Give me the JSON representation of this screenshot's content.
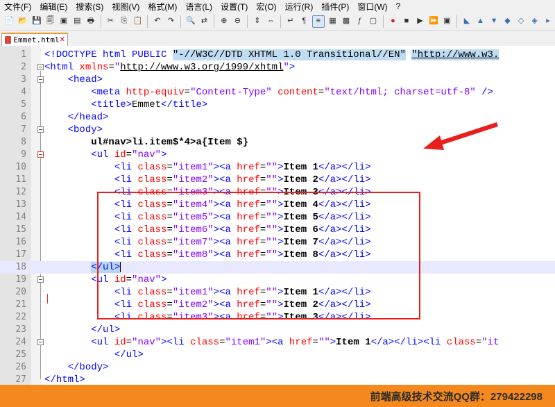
{
  "menu": [
    "文件(F)",
    "编辑(E)",
    "搜索(S)",
    "视图(V)",
    "格式(M)",
    "语言(L)",
    "设置(T)",
    "宏(O)",
    "运行(R)",
    "插件(P)",
    "窗口(W)",
    "?"
  ],
  "tab": {
    "title": "Emmet.html",
    "close": "✕"
  },
  "lines": [
    {
      "n": "1",
      "cur": false,
      "fold": null,
      "tokens": [
        {
          "c": "t",
          "x": "<!DOCTYPE html PUBLIC "
        },
        {
          "c": "hl",
          "x": "\"-//W3C//DTD XHTML 1.0 Transitional//EN\""
        },
        {
          "c": "d",
          "x": " "
        },
        {
          "c": "hl u",
          "x": "\"http://www.w3."
        }
      ]
    },
    {
      "n": "2",
      "cur": false,
      "fold": "open",
      "tokens": [
        {
          "c": "t",
          "x": "<html "
        },
        {
          "c": "a",
          "x": "xmlns"
        },
        {
          "c": "d",
          "x": "="
        },
        {
          "c": "s",
          "x": "\""
        },
        {
          "c": "s u",
          "x": "http://www.w3.org/1999/xhtml"
        },
        {
          "c": "s",
          "x": "\""
        },
        {
          "c": "t",
          "x": ">"
        }
      ]
    },
    {
      "n": "3",
      "cur": false,
      "fold": "open",
      "tokens": [
        {
          "c": "d",
          "x": "    "
        },
        {
          "c": "t",
          "x": "<head>"
        }
      ]
    },
    {
      "n": "4",
      "cur": false,
      "fold": null,
      "tokens": [
        {
          "c": "d",
          "x": "        "
        },
        {
          "c": "t",
          "x": "<meta "
        },
        {
          "c": "a",
          "x": "http-equiv"
        },
        {
          "c": "d",
          "x": "="
        },
        {
          "c": "s",
          "x": "\"Content-Type\""
        },
        {
          "c": "d",
          "x": " "
        },
        {
          "c": "a",
          "x": "content"
        },
        {
          "c": "d",
          "x": "="
        },
        {
          "c": "s",
          "x": "\"text/html; charset=utf-8\""
        },
        {
          "c": "d",
          "x": " "
        },
        {
          "c": "t",
          "x": "/>"
        }
      ]
    },
    {
      "n": "5",
      "cur": false,
      "fold": null,
      "tokens": [
        {
          "c": "d",
          "x": "        "
        },
        {
          "c": "t",
          "x": "<title>"
        },
        {
          "c": "d",
          "x": "Emmet"
        },
        {
          "c": "t",
          "x": "</title>"
        }
      ]
    },
    {
      "n": "6",
      "cur": false,
      "fold": null,
      "tokens": [
        {
          "c": "d",
          "x": "    "
        },
        {
          "c": "t",
          "x": "</head>"
        }
      ]
    },
    {
      "n": "7",
      "cur": false,
      "fold": "open",
      "tokens": [
        {
          "c": "d",
          "x": "    "
        },
        {
          "c": "t",
          "x": "<body>"
        }
      ]
    },
    {
      "n": "8",
      "cur": false,
      "fold": null,
      "tokens": [
        {
          "c": "d",
          "x": "        "
        },
        {
          "c": "d bold",
          "x": "ul#nav>li.item$*4>a{Item $}"
        }
      ]
    },
    {
      "n": "9",
      "cur": false,
      "fold": "red",
      "tokens": [
        {
          "c": "d",
          "x": "        "
        },
        {
          "c": "t",
          "x": "<ul "
        },
        {
          "c": "a",
          "x": "id"
        },
        {
          "c": "d",
          "x": "="
        },
        {
          "c": "s",
          "x": "\"nav\""
        },
        {
          "c": "t",
          "x": ">"
        }
      ]
    },
    {
      "n": "10",
      "cur": false,
      "fold": null,
      "tokens": [
        {
          "c": "d",
          "x": "            "
        },
        {
          "c": "t",
          "x": "<li "
        },
        {
          "c": "a",
          "x": "class"
        },
        {
          "c": "d",
          "x": "="
        },
        {
          "c": "s",
          "x": "\"item1\""
        },
        {
          "c": "t",
          "x": "><a "
        },
        {
          "c": "a",
          "x": "href"
        },
        {
          "c": "d",
          "x": "="
        },
        {
          "c": "s",
          "x": "\"\""
        },
        {
          "c": "t",
          "x": ">"
        },
        {
          "c": "d bold",
          "x": "Item 1"
        },
        {
          "c": "t",
          "x": "</a></li>"
        }
      ]
    },
    {
      "n": "11",
      "cur": false,
      "fold": null,
      "tokens": [
        {
          "c": "d",
          "x": "            "
        },
        {
          "c": "t",
          "x": "<li "
        },
        {
          "c": "a",
          "x": "class"
        },
        {
          "c": "d",
          "x": "="
        },
        {
          "c": "s",
          "x": "\"item2\""
        },
        {
          "c": "t",
          "x": "><a "
        },
        {
          "c": "a",
          "x": "href"
        },
        {
          "c": "d",
          "x": "="
        },
        {
          "c": "s",
          "x": "\"\""
        },
        {
          "c": "t",
          "x": ">"
        },
        {
          "c": "d bold",
          "x": "Item 2"
        },
        {
          "c": "t",
          "x": "</a></li>"
        }
      ]
    },
    {
      "n": "12",
      "cur": false,
      "fold": null,
      "tokens": [
        {
          "c": "d",
          "x": "            "
        },
        {
          "c": "t",
          "x": "<li "
        },
        {
          "c": "a",
          "x": "class"
        },
        {
          "c": "d",
          "x": "="
        },
        {
          "c": "s",
          "x": "\"item3\""
        },
        {
          "c": "t",
          "x": "><a "
        },
        {
          "c": "a",
          "x": "href"
        },
        {
          "c": "d",
          "x": "="
        },
        {
          "c": "s",
          "x": "\"\""
        },
        {
          "c": "t",
          "x": ">"
        },
        {
          "c": "d bold",
          "x": "Item 3"
        },
        {
          "c": "t",
          "x": "</a></li>"
        }
      ]
    },
    {
      "n": "13",
      "cur": false,
      "fold": null,
      "tokens": [
        {
          "c": "d",
          "x": "            "
        },
        {
          "c": "t",
          "x": "<li "
        },
        {
          "c": "a",
          "x": "class"
        },
        {
          "c": "d",
          "x": "="
        },
        {
          "c": "s",
          "x": "\"item4\""
        },
        {
          "c": "t",
          "x": "><a "
        },
        {
          "c": "a",
          "x": "href"
        },
        {
          "c": "d",
          "x": "="
        },
        {
          "c": "s",
          "x": "\"\""
        },
        {
          "c": "t",
          "x": ">"
        },
        {
          "c": "d bold",
          "x": "Item 4"
        },
        {
          "c": "t",
          "x": "</a></li>"
        }
      ]
    },
    {
      "n": "14",
      "cur": false,
      "fold": null,
      "tokens": [
        {
          "c": "d",
          "x": "            "
        },
        {
          "c": "t",
          "x": "<li "
        },
        {
          "c": "a",
          "x": "class"
        },
        {
          "c": "d",
          "x": "="
        },
        {
          "c": "s",
          "x": "\"item5\""
        },
        {
          "c": "t",
          "x": "><a "
        },
        {
          "c": "a",
          "x": "href"
        },
        {
          "c": "d",
          "x": "="
        },
        {
          "c": "s",
          "x": "\"\""
        },
        {
          "c": "t",
          "x": ">"
        },
        {
          "c": "d bold",
          "x": "Item 5"
        },
        {
          "c": "t",
          "x": "</a></li>"
        }
      ]
    },
    {
      "n": "15",
      "cur": false,
      "fold": null,
      "tokens": [
        {
          "c": "d",
          "x": "            "
        },
        {
          "c": "t",
          "x": "<li "
        },
        {
          "c": "a",
          "x": "class"
        },
        {
          "c": "d",
          "x": "="
        },
        {
          "c": "s",
          "x": "\"item6\""
        },
        {
          "c": "t",
          "x": "><a "
        },
        {
          "c": "a",
          "x": "href"
        },
        {
          "c": "d",
          "x": "="
        },
        {
          "c": "s",
          "x": "\"\""
        },
        {
          "c": "t",
          "x": ">"
        },
        {
          "c": "d bold",
          "x": "Item 6"
        },
        {
          "c": "t",
          "x": "</a></li>"
        }
      ]
    },
    {
      "n": "16",
      "cur": false,
      "fold": null,
      "tokens": [
        {
          "c": "d",
          "x": "            "
        },
        {
          "c": "t",
          "x": "<li "
        },
        {
          "c": "a",
          "x": "class"
        },
        {
          "c": "d",
          "x": "="
        },
        {
          "c": "s",
          "x": "\"item7\""
        },
        {
          "c": "t",
          "x": "><a "
        },
        {
          "c": "a",
          "x": "href"
        },
        {
          "c": "d",
          "x": "="
        },
        {
          "c": "s",
          "x": "\"\""
        },
        {
          "c": "t",
          "x": ">"
        },
        {
          "c": "d bold",
          "x": "Item 7"
        },
        {
          "c": "t",
          "x": "</a></li>"
        }
      ]
    },
    {
      "n": "17",
      "cur": false,
      "fold": null,
      "tokens": [
        {
          "c": "d",
          "x": "            "
        },
        {
          "c": "t",
          "x": "<li "
        },
        {
          "c": "a",
          "x": "class"
        },
        {
          "c": "d",
          "x": "="
        },
        {
          "c": "s",
          "x": "\"item8\""
        },
        {
          "c": "t",
          "x": "><a "
        },
        {
          "c": "a",
          "x": "href"
        },
        {
          "c": "d",
          "x": "="
        },
        {
          "c": "s",
          "x": "\"\""
        },
        {
          "c": "t",
          "x": ">"
        },
        {
          "c": "d bold",
          "x": "Item 8"
        },
        {
          "c": "t",
          "x": "</a></li>"
        }
      ]
    },
    {
      "n": "18",
      "cur": true,
      "fold": null,
      "tokens": [
        {
          "c": "d",
          "x": "        "
        },
        {
          "c": "t hl2",
          "x": "</ul>"
        }
      ]
    },
    {
      "n": "19",
      "cur": false,
      "fold": "open",
      "tokens": [
        {
          "c": "d",
          "x": "        "
        },
        {
          "c": "t",
          "x": "<ul "
        },
        {
          "c": "a",
          "x": "id"
        },
        {
          "c": "d",
          "x": "="
        },
        {
          "c": "s",
          "x": "\"nav\""
        },
        {
          "c": "t",
          "x": ">"
        }
      ]
    },
    {
      "n": "20",
      "cur": false,
      "fold": null,
      "tokens": [
        {
          "c": "d",
          "x": "            "
        },
        {
          "c": "t",
          "x": "<li "
        },
        {
          "c": "a",
          "x": "class"
        },
        {
          "c": "d",
          "x": "="
        },
        {
          "c": "s",
          "x": "\"item1\""
        },
        {
          "c": "t",
          "x": "><a "
        },
        {
          "c": "a",
          "x": "href"
        },
        {
          "c": "d",
          "x": "="
        },
        {
          "c": "s",
          "x": "\"\""
        },
        {
          "c": "t",
          "x": ">"
        },
        {
          "c": "d bold",
          "x": "Item 1"
        },
        {
          "c": "t",
          "x": "</a></li>"
        }
      ]
    },
    {
      "n": "21",
      "cur": false,
      "fold": null,
      "tokens": [
        {
          "c": "d",
          "x": "            "
        },
        {
          "c": "t",
          "x": "<li "
        },
        {
          "c": "a",
          "x": "class"
        },
        {
          "c": "d",
          "x": "="
        },
        {
          "c": "s",
          "x": "\"item2\""
        },
        {
          "c": "t",
          "x": "><a "
        },
        {
          "c": "a",
          "x": "href"
        },
        {
          "c": "d",
          "x": "="
        },
        {
          "c": "s",
          "x": "\"\""
        },
        {
          "c": "t",
          "x": ">"
        },
        {
          "c": "d bold",
          "x": "Item 2"
        },
        {
          "c": "t",
          "x": "</a></li>"
        }
      ]
    },
    {
      "n": "22",
      "cur": false,
      "fold": null,
      "tokens": [
        {
          "c": "d",
          "x": "            "
        },
        {
          "c": "t",
          "x": "<li "
        },
        {
          "c": "a",
          "x": "class"
        },
        {
          "c": "d",
          "x": "="
        },
        {
          "c": "s",
          "x": "\"item3\""
        },
        {
          "c": "t",
          "x": "><a "
        },
        {
          "c": "a",
          "x": "href"
        },
        {
          "c": "d",
          "x": "="
        },
        {
          "c": "s",
          "x": "\"\""
        },
        {
          "c": "t",
          "x": ">"
        },
        {
          "c": "d bold",
          "x": "Item 3"
        },
        {
          "c": "t",
          "x": "</a></li>"
        }
      ]
    },
    {
      "n": "23",
      "cur": false,
      "fold": null,
      "tokens": [
        {
          "c": "d",
          "x": "        "
        },
        {
          "c": "t",
          "x": "</ul>"
        }
      ]
    },
    {
      "n": "24",
      "cur": false,
      "fold": "open",
      "tokens": [
        {
          "c": "d",
          "x": "        "
        },
        {
          "c": "t",
          "x": "<ul "
        },
        {
          "c": "a",
          "x": "id"
        },
        {
          "c": "d",
          "x": "="
        },
        {
          "c": "s",
          "x": "\"nav\""
        },
        {
          "c": "t",
          "x": "><li "
        },
        {
          "c": "a",
          "x": "class"
        },
        {
          "c": "d",
          "x": "="
        },
        {
          "c": "s",
          "x": "\"item1\""
        },
        {
          "c": "t",
          "x": "><a "
        },
        {
          "c": "a",
          "x": "href"
        },
        {
          "c": "d",
          "x": "="
        },
        {
          "c": "s",
          "x": "\"\""
        },
        {
          "c": "t",
          "x": ">"
        },
        {
          "c": "d bold",
          "x": "Item 1"
        },
        {
          "c": "t",
          "x": "</a></li><li "
        },
        {
          "c": "a",
          "x": "class"
        },
        {
          "c": "d",
          "x": "="
        },
        {
          "c": "s",
          "x": "\"it"
        }
      ]
    },
    {
      "n": "25",
      "cur": false,
      "fold": null,
      "tokens": [
        {
          "c": "d",
          "x": "            "
        },
        {
          "c": "t",
          "x": "</ul>"
        }
      ]
    },
    {
      "n": "26",
      "cur": false,
      "fold": null,
      "tokens": [
        {
          "c": "d",
          "x": "    "
        },
        {
          "c": "t",
          "x": "</body>"
        }
      ]
    },
    {
      "n": "27",
      "cur": false,
      "fold": null,
      "tokens": [
        {
          "c": "t",
          "x": "</html>"
        }
      ]
    }
  ],
  "footer": {
    "text": "前端高级技术交流QQ群：279422298"
  },
  "colors": {
    "footer_bg": "#f5891e",
    "box": "#e8201c",
    "tag": "#0000ff",
    "attr": "#ff0000",
    "string": "#8000ff"
  }
}
